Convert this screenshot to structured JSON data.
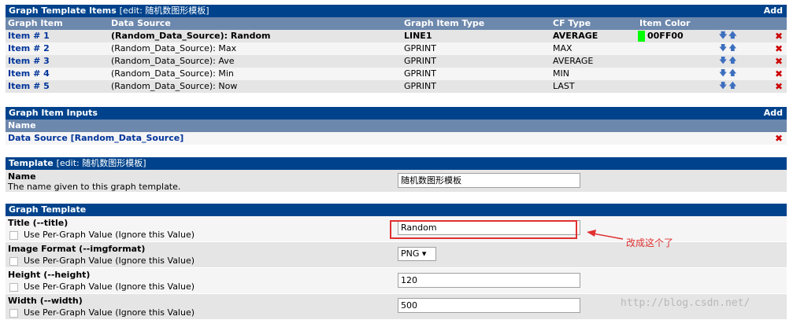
{
  "items_panel": {
    "title": "Graph Template Items",
    "edit_note": "[edit: 随机数图形模板]",
    "add_label": "Add",
    "columns": [
      "Graph Item",
      "Data Source",
      "Graph Item Type",
      "CF Type",
      "Item Color"
    ],
    "rows": [
      {
        "item": "Item # 1",
        "source": "(Random_Data_Source): Random",
        "type": "LINE1",
        "cf": "AVERAGE",
        "color": "00FF00",
        "arrows": "🡇🡅",
        "del": "✖"
      },
      {
        "item": "Item # 2",
        "source": "(Random_Data_Source): Max",
        "type": "GPRINT",
        "cf": "MAX",
        "color": "",
        "arrows": "🡇🡅",
        "del": "✖"
      },
      {
        "item": "Item # 3",
        "source": "(Random_Data_Source): Ave",
        "type": "GPRINT",
        "cf": "AVERAGE",
        "color": "",
        "arrows": "🡇🡅",
        "del": "✖"
      },
      {
        "item": "Item # 4",
        "source": "(Random_Data_Source): Min",
        "type": "GPRINT",
        "cf": "MIN",
        "color": "",
        "arrows": "🡇🡅",
        "del": "✖"
      },
      {
        "item": "Item # 5",
        "source": "(Random_Data_Source): Now",
        "type": "GPRINT",
        "cf": "LAST",
        "color": "",
        "arrows": "🡇🡅",
        "del": "✖"
      }
    ]
  },
  "inputs_panel": {
    "title": "Graph Item Inputs",
    "add_label": "Add",
    "column": "Name",
    "row_label": "Data Source [Random_Data_Source]",
    "del": "✖"
  },
  "template_panel": {
    "title": "Template",
    "edit_note": "[edit: 随机数图形模板]",
    "name_label": "Name",
    "name_desc": "The name given to this graph template.",
    "name_value": "随机数图形模板"
  },
  "graph_panel": {
    "title": "Graph Template",
    "per_graph_label": "Use Per-Graph Value (Ignore this Value)",
    "title_label": "Title (--title)",
    "title_value": "Random",
    "format_label": "Image Format (--imgformat)",
    "format_value": "PNG ▾",
    "height_label": "Height (--height)",
    "height_value": "120",
    "width_label": "Width (--width)",
    "width_value": "500"
  },
  "annotation": {
    "text": "改成这个了"
  },
  "watermark": "http://blog.csdn.net/",
  "colors": {
    "header": "#00438C",
    "subheader": "#6D88AD",
    "link": "#00349A",
    "annotation": "#E03030",
    "swatch": "#00FF00"
  }
}
